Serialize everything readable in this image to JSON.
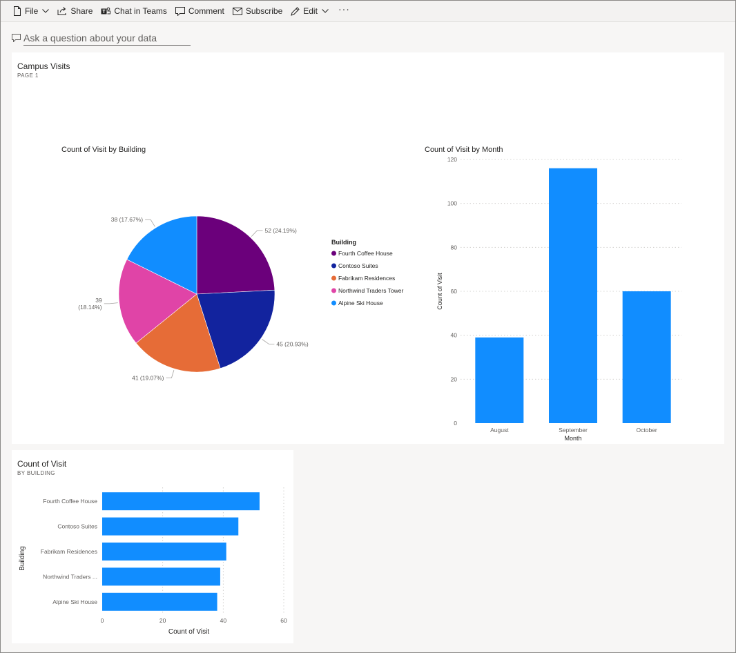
{
  "toolbar": {
    "file_label": "File",
    "share_label": "Share",
    "teams_label": "Chat in Teams",
    "comment_label": "Comment",
    "subscribe_label": "Subscribe",
    "edit_label": "Edit",
    "more_label": "···"
  },
  "qa": {
    "placeholder": "Ask a question about your data"
  },
  "tile1": {
    "title": "Campus Visits",
    "subtitle": "PAGE 1"
  },
  "tile2": {
    "title": "Count of Visit",
    "subtitle": "BY BUILDING"
  },
  "colors": {
    "accent": "#118dff",
    "fourth_coffee": "#6b007b",
    "contoso": "#12239e",
    "fabrikam": "#e66c37",
    "northwind": "#e044a7",
    "alpine": "#118dff"
  },
  "chart_data": [
    {
      "type": "pie",
      "title": "Count of Visit by Building",
      "legend_title": "Building",
      "legend_position": "right",
      "categories": [
        "Fourth Coffee House",
        "Contoso Suites",
        "Fabrikam Residences",
        "Northwind Traders Tower",
        "Alpine Ski House"
      ],
      "values": [
        52,
        45,
        41,
        39,
        38
      ],
      "data_labels": [
        "52 (24.19%)",
        "45 (20.93%)",
        "41 (19.07%)",
        "39 (18.14%)",
        "38 (17.67%)"
      ],
      "colors": [
        "#6b007b",
        "#12239e",
        "#e66c37",
        "#e044a7",
        "#118dff"
      ]
    },
    {
      "type": "bar",
      "title": "Count of Visit by Month",
      "xlabel": "Month",
      "ylabel": "Count of Visit",
      "categories": [
        "August",
        "September",
        "October"
      ],
      "values": [
        39,
        116,
        60
      ],
      "ylim": [
        0,
        120
      ],
      "yticks": [
        0,
        20,
        40,
        60,
        80,
        100,
        120
      ],
      "grid": true,
      "color": "#118dff"
    },
    {
      "type": "bar",
      "orientation": "horizontal",
      "xlabel": "Count of Visit",
      "ylabel": "Building",
      "categories": [
        "Fourth Coffee House",
        "Contoso Suites",
        "Fabrikam Residences",
        "Northwind Traders ...",
        "Alpine Ski House"
      ],
      "values": [
        52,
        45,
        41,
        39,
        38
      ],
      "xlim": [
        0,
        60
      ],
      "xticks": [
        0,
        20,
        40,
        60
      ],
      "grid": true,
      "color": "#118dff"
    }
  ]
}
